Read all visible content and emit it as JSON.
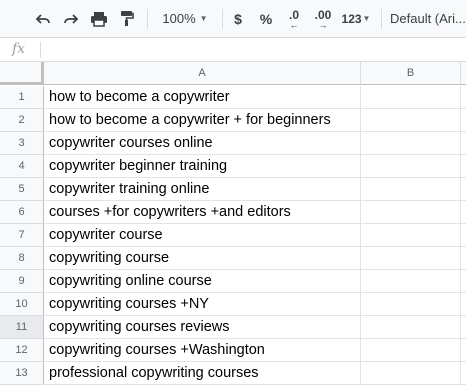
{
  "toolbar": {
    "zoom": "100%",
    "currency": "$",
    "percent": "%",
    "decrease_decimals": ".0",
    "increase_decimals": ".00",
    "more_formats": "123",
    "font": "Default (Ari..."
  },
  "formula_bar": {
    "fx_label": "fx",
    "value": ""
  },
  "columns": [
    "A",
    "B"
  ],
  "rows": [
    {
      "num": "1",
      "a": "how to become a copywriter",
      "b": ""
    },
    {
      "num": "2",
      "a": "how to become a copywriter + for beginners",
      "b": ""
    },
    {
      "num": "3",
      "a": "copywriter courses online",
      "b": ""
    },
    {
      "num": "4",
      "a": "copywriter beginner training",
      "b": ""
    },
    {
      "num": "5",
      "a": "copywriter training online",
      "b": ""
    },
    {
      "num": "6",
      "a": "courses +for copywriters +and editors",
      "b": ""
    },
    {
      "num": "7",
      "a": "copywriter course",
      "b": ""
    },
    {
      "num": "8",
      "a": "copywriting course",
      "b": ""
    },
    {
      "num": "9",
      "a": "copywriting online course",
      "b": ""
    },
    {
      "num": "10",
      "a": "copywriting courses +NY",
      "b": ""
    },
    {
      "num": "11",
      "a": "copywriting courses reviews",
      "b": ""
    },
    {
      "num": "12",
      "a": "copywriting courses +Washington",
      "b": ""
    },
    {
      "num": "13",
      "a": "professional copywriting courses",
      "b": ""
    }
  ]
}
